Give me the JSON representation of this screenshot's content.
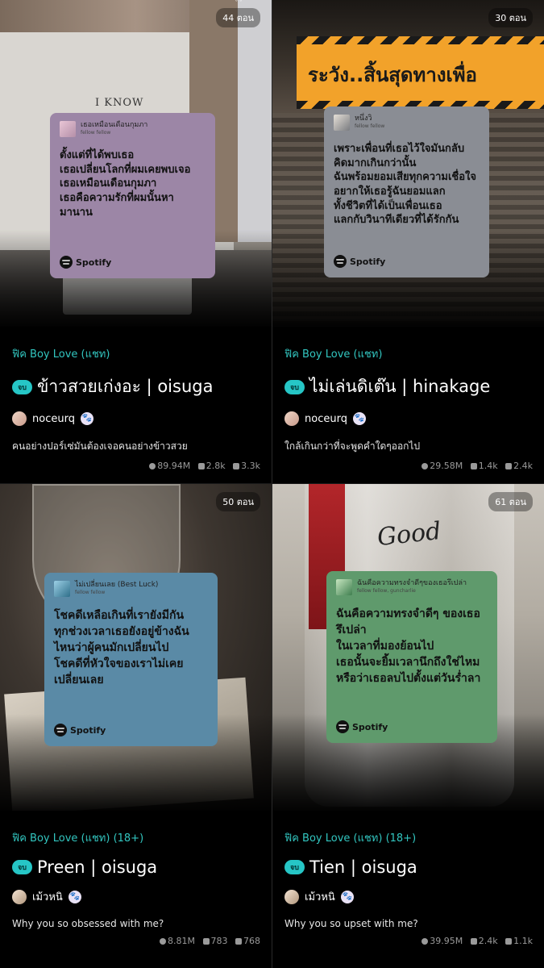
{
  "cards": [
    {
      "episodes": "44 ตอน",
      "cover_text": "I KNOW",
      "spotify": {
        "song": "เธอเหมือนเดือนกุมภา",
        "artist": "fellow fellow",
        "lyrics": "ตั้งแต่ที่ได้พบเธอ\nเธอเปลี่ยนโลกที่ผมเคยพบเจอ\nเธอเหมือนเดือนกุมภา\nเธอคือความรักที่ผมนั้นหา\nมานาน",
        "brand": "Spotify"
      },
      "genre": "ฟิค Boy Love (แชท)",
      "badge": "จบ",
      "title": "ข้าวสวยเก่งอะ | oisuga",
      "author": "noceurq",
      "description": "คนอย่างปอร์เซ่มันต้องเจอคนอย่างข้าวสวย",
      "stats": {
        "views": "89.94M",
        "comments": "2.8k",
        "likes": "3.3k"
      }
    },
    {
      "episodes": "30 ตอน",
      "cover_text": "ระวัง..สิ้นสุดทางเพื่อ",
      "spotify": {
        "song": "หนึ่งวิ",
        "artist": "fellow fellow",
        "lyrics": "เพราะเพื่อนที่เธอไว้ใจมันกลับ\nคิดมากเกินกว่านั้น\nฉันพร้อมยอมเสียทุกความเชื่อใจ\nอยากให้เธอรู้ฉันยอมแลก\nทั้งชีวิตที่ได้เป็นเพื่อนเธอ\nแลกกับวินาทีเดียวที่ได้รักกัน",
        "brand": "Spotify"
      },
      "genre": "ฟิค Boy Love (แชท)",
      "badge": "จบ",
      "title": "ไม่เล่นดิเต๊น | hinakage",
      "author": "noceurq",
      "description": "ใกล้เกินกว่าที่จะพูดคำใดๆออกไป",
      "stats": {
        "views": "29.58M",
        "comments": "1.4k",
        "likes": "2.4k"
      }
    },
    {
      "episodes": "50 ตอน",
      "spotify": {
        "song": "ไม่เปลี่ยนเลย (Best Luck)",
        "artist": "fellow fellow",
        "lyrics": "โชคดีเหลือเกินที่เรายังมีกัน\nทุกช่วงเวลาเธอยังอยู่ข้างฉัน\nไหนว่าผู้คนมักเปลี่ยนไป\nโชคดีที่หัวใจของเราไม่เคย\nเปลี่ยนเลย",
        "brand": "Spotify"
      },
      "genre": "ฟิค Boy Love (แชท) (18+)",
      "badge": "จบ",
      "title": "Preen | oisuga",
      "author": "เม้วหนิ",
      "description": "Why you so obsessed with me?",
      "stats": {
        "views": "8.81M",
        "comments": "783",
        "likes": "768"
      }
    },
    {
      "episodes": "61 ตอน",
      "cover_text": "Good",
      "spotify": {
        "song": "ฉันคือความทรงจำดีๆของเธอรึเปล่า",
        "artist": "fellow fellow, guncharlie",
        "lyrics": "ฉันคือความทรงจำดีๆ ของเธอ\nรึเปล่า\nในเวลาที่มองย้อนไป\nเธอนั้นจะยิ้มเวลานึกถึงใช่ไหม\nหรือว่าเธอลบไปตั้งแต่วันร่ำลา",
        "brand": "Spotify"
      },
      "genre": "ฟิค Boy Love (แชท) (18+)",
      "badge": "จบ",
      "title": "Tien | oisuga",
      "author": "เม้วหนิ",
      "description": "Why you so upset with me?",
      "stats": {
        "views": "39.95M",
        "comments": "2.4k",
        "likes": "1.1k"
      }
    }
  ],
  "icons": {
    "views": "eye-icon",
    "comments": "comment-icon",
    "likes": "bookmark-icon",
    "author_badge": "paw-icon",
    "spotify": "spotify-logo-icon"
  },
  "colors": {
    "genre": "#32c6c0",
    "badge": "#26c6c6",
    "card_purple": "#9c86a6",
    "card_gray": "#8a8d94",
    "card_blue": "#5a8aa6",
    "card_green": "#5f9a6c"
  }
}
